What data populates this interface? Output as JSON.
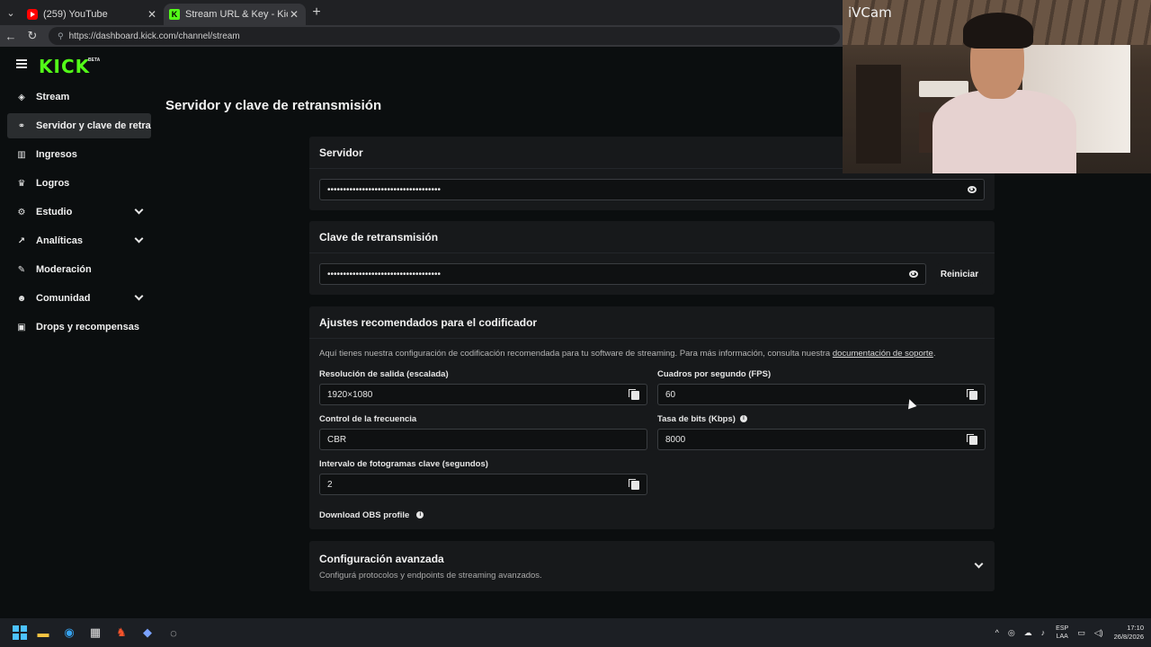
{
  "browser": {
    "tabs": [
      {
        "title": "(259) YouTube",
        "favicon": "youtube-icon",
        "active": false
      },
      {
        "title": "Stream URL & Key - Kick Dashboard",
        "favicon": "kick-icon",
        "active": true
      }
    ],
    "url": "https://dashboard.kick.com/channel/stream"
  },
  "brand": {
    "logo": "KICK",
    "badge": "BETA",
    "accent": "#53fc18"
  },
  "sidebar": {
    "items": [
      {
        "label": "Stream",
        "icon": "broadcast-icon",
        "expandable": false
      },
      {
        "label": "Servidor y clave de retransmisión",
        "icon": "link-icon",
        "expandable": false,
        "active": true
      },
      {
        "label": "Ingresos",
        "icon": "chart-bars-icon",
        "expandable": false
      },
      {
        "label": "Logros",
        "icon": "trophy-icon",
        "expandable": false
      },
      {
        "label": "Estudio",
        "icon": "settings-icon",
        "expandable": true
      },
      {
        "label": "Analíticas",
        "icon": "analytics-icon",
        "expandable": true
      },
      {
        "label": "Moderación",
        "icon": "wrench-icon",
        "expandable": false
      },
      {
        "label": "Comunidad",
        "icon": "people-icon",
        "expandable": true
      },
      {
        "label": "Drops y recompensas",
        "icon": "gift-icon",
        "expandable": false
      }
    ]
  },
  "main": {
    "title": "Servidor y clave de retransmisión",
    "server": {
      "heading": "Servidor",
      "value": "••••••••••••••••••••••••••••••••••••"
    },
    "key": {
      "heading": "Clave de retransmisión",
      "value": "••••••••••••••••••••••••••••••••••••",
      "reset_label": "Reiniciar"
    },
    "encoder": {
      "heading": "Ajustes recomendados para el codificador",
      "description": "Aquí tienes nuestra configuración de codificación recomendada para tu software de streaming. Para más información, consulta nuestra ",
      "link": "documentación de soporte",
      "period": ".",
      "resolution_label": "Resolución de salida (escalada)",
      "resolution_value": "1920×1080",
      "fps_label": "Cuadros por segundo (FPS)",
      "fps_value": "60",
      "rate_control_label": "Control de la frecuencia",
      "rate_control_value": "CBR",
      "bitrate_label": "Tasa de bits (Kbps)",
      "bitrate_value": "8000",
      "keyframe_label": "Intervalo de fotogramas clave (segundos)",
      "keyframe_value": "2",
      "obs_label": "Download OBS profile"
    },
    "advanced": {
      "heading": "Configuración avanzada",
      "subtitle": "Configurá protocolos y endpoints de streaming avanzados."
    }
  },
  "webcam": {
    "label": "iVCam"
  },
  "taskbar": {
    "lang_top": "ESP",
    "lang_bottom": "LAA",
    "time": "17:10",
    "date": "26/8/2026"
  }
}
